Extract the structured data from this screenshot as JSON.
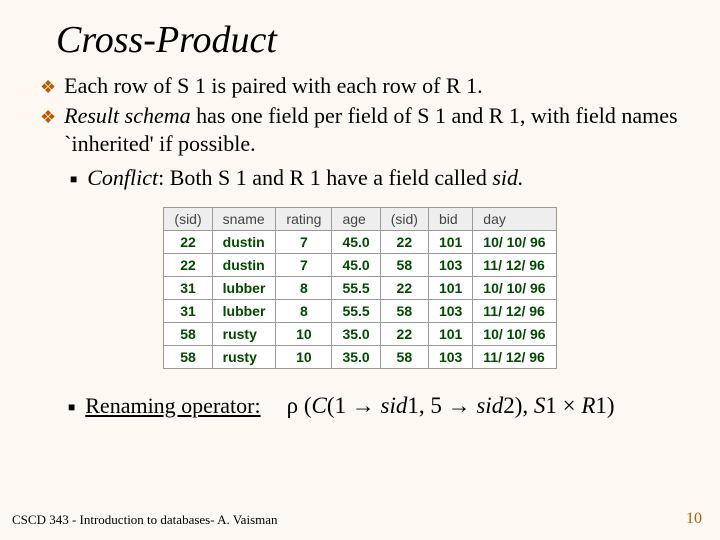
{
  "title": "Cross-Product",
  "bullets": {
    "b1": "Each row of S 1 is paired with each row of R 1.",
    "b2_pre": "Result schema",
    "b2_rest": " has one field per field of S 1 and R 1, with field names `inherited' if possible.",
    "b3_pre": "Conflict",
    "b3_rest": ":  Both S 1 and R 1 have a field called ",
    "b3_sid": "sid."
  },
  "table": {
    "headers": [
      "(sid)",
      "sname",
      "rating",
      "age",
      "(sid)",
      "bid",
      "day"
    ],
    "rows": [
      [
        "22",
        "dustin",
        "7",
        "45.0",
        "22",
        "101",
        "10/ 10/ 96"
      ],
      [
        "22",
        "dustin",
        "7",
        "45.0",
        "58",
        "103",
        "11/ 12/ 96"
      ],
      [
        "31",
        "lubber",
        "8",
        "55.5",
        "22",
        "101",
        "10/ 10/ 96"
      ],
      [
        "31",
        "lubber",
        "8",
        "55.5",
        "58",
        "103",
        "11/ 12/ 96"
      ],
      [
        "58",
        "rusty",
        "10",
        "35.0",
        "22",
        "101",
        "10/ 10/ 96"
      ],
      [
        "58",
        "rusty",
        "10",
        "35.0",
        "58",
        "103",
        "11/ 12/ 96"
      ]
    ]
  },
  "rename": {
    "label": " Renaming operator:",
    "rho": "ρ",
    "open": " (",
    "C": "C",
    "p1": "(1 → ",
    "sid1": "sid",
    "one": "1, 5 → ",
    "sid2": "sid",
    "two": "2), ",
    "S1": "S",
    "s1n": "1 × ",
    "R1": "R",
    "r1n": "1)",
    "close": ""
  },
  "footer": {
    "left": "CSCD 343 - Introduction to databases- A. Vaisman",
    "right": "10"
  }
}
